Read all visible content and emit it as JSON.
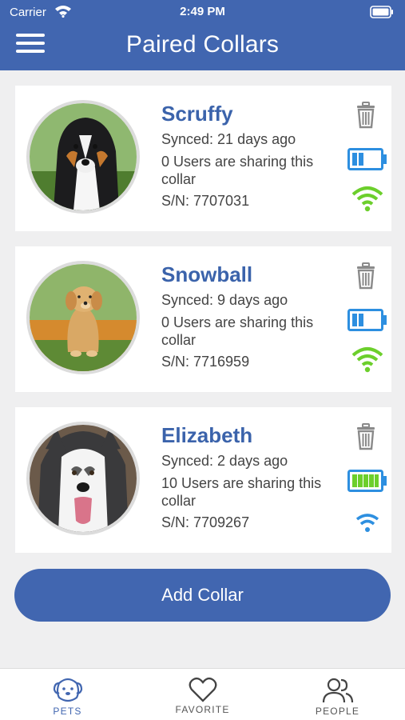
{
  "status_bar": {
    "carrier": "Carrier",
    "time": "2:49 PM"
  },
  "header": {
    "title": "Paired Collars"
  },
  "collars": [
    {
      "name": "Scruffy",
      "synced": "Synced: 21 days ago",
      "sharing": "0 Users are sharing this collar",
      "serial": "S/N: 7707031",
      "battery_level": 0.4,
      "signal": "strong",
      "signal_color": "#6ccf2c"
    },
    {
      "name": "Snowball",
      "synced": "Synced: 9 days ago",
      "sharing": "0 Users are sharing this collar",
      "serial": "S/N: 7716959",
      "battery_level": 0.4,
      "signal": "strong",
      "signal_color": "#6ccf2c"
    },
    {
      "name": "Elizabeth",
      "synced": "Synced: 2 days ago",
      "sharing": "10 Users are sharing this collar",
      "serial": "S/N: 7709267",
      "battery_level": 1.0,
      "signal": "weak",
      "signal_color": "#2d8fe0"
    }
  ],
  "add_button": {
    "label": "Add Collar"
  },
  "tabs": [
    {
      "label": "PETS",
      "icon": "dog-face-icon",
      "active": true
    },
    {
      "label": "FAVORITE",
      "icon": "heart-icon",
      "active": false
    },
    {
      "label": "PEOPLE",
      "icon": "people-icon",
      "active": false
    }
  ],
  "colors": {
    "brand": "#4166b0",
    "battery_blue": "#2d8fe0",
    "battery_green": "#6ccf2c"
  }
}
